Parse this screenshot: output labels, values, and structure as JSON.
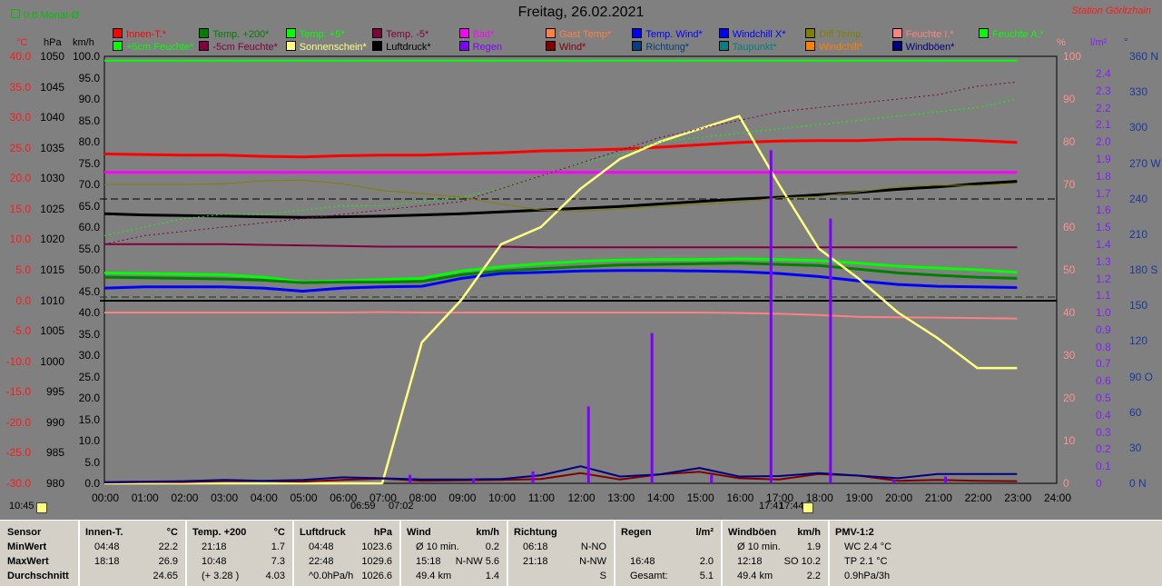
{
  "header": {
    "title": "Freitag, 26.02.2021",
    "station": "Station Göritzhain",
    "monat": "0.8 Monat-Ø"
  },
  "legend": [
    {
      "label": "Innen-T.*",
      "color": "#ff0000"
    },
    {
      "label": "Temp. +200*",
      "color": "#008000"
    },
    {
      "label": "Temp. +5*",
      "color": "#00ff00"
    },
    {
      "label": "Temp. -5*",
      "color": "#800040"
    },
    {
      "label": "Bad*",
      "color": "#ff00ff"
    },
    {
      "label": "Gast Temp*",
      "color": "#ff8040"
    },
    {
      "label": "Temp. Wind*",
      "color": "#0000ff"
    },
    {
      "label": "Windchill X*",
      "color": "#0000ff"
    },
    {
      "label": "Diff Temp.",
      "color": "#808000"
    },
    {
      "label": "Feuchte I.*",
      "color": "#ff8080"
    },
    {
      "label": "Feuchte A.*",
      "color": "#00ff00"
    },
    {
      "label": "+5cm Feuchte*",
      "color": "#00ff00"
    },
    {
      "label": "-5cm Feuchte*",
      "color": "#800040"
    },
    {
      "label": "Sonnenschein*",
      "color": "#ffff80"
    },
    {
      "label": "Luftdruck*",
      "color": "#000000"
    },
    {
      "label": "Regen",
      "color": "#8000ff"
    },
    {
      "label": "Wind*",
      "color": "#800000"
    },
    {
      "label": "Richtung*",
      "color": "#004080"
    },
    {
      "label": "Taupunkt*",
      "color": "#008080"
    },
    {
      "label": "Windchill*",
      "color": "#ff8000"
    },
    {
      "label": "Windböen*",
      "color": "#000080"
    }
  ],
  "axis_units": {
    "temp": "°C",
    "hpa": "hPa",
    "kmh": "km/h",
    "pct": "%",
    "rain": "l/m²",
    "dir": "°"
  },
  "axis_ticks": {
    "temp": [
      "40.0",
      "35.0",
      "30.0",
      "25.0",
      "20.0",
      "15.0",
      "10.0",
      "5.0",
      "0.0",
      "-5.0",
      "-10.0",
      "-15.0",
      "-20.0",
      "-25.0",
      "-30.0"
    ],
    "hpa": [
      "1050",
      "1045",
      "1040",
      "1035",
      "1030",
      "1025",
      "1020",
      "1015",
      "1010",
      "1005",
      "1000",
      "995",
      "990",
      "985",
      "980"
    ],
    "kmh": [
      "100.0",
      "95.0",
      "90.0",
      "85.0",
      "80.0",
      "75.0",
      "70.0",
      "65.0",
      "60.0",
      "55.0",
      "50.0",
      "45.0",
      "40.0",
      "35.0",
      "30.0",
      "25.0",
      "20.0",
      "15.0",
      "10.0",
      "5.0",
      "0.0"
    ],
    "pct": [
      "100",
      "90",
      "80",
      "70",
      "60",
      "50",
      "40",
      "30",
      "20",
      "10",
      "0"
    ],
    "rain": [
      "2.4",
      "2.3",
      "2.2",
      "2.1",
      "2.0",
      "1.9",
      "1.8",
      "1.7",
      "1.6",
      "1.5",
      "1.4",
      "1.3",
      "1.2",
      "1.1",
      "1.0",
      "0.9",
      "0.8",
      "0.7",
      "0.6",
      "0.5",
      "0.4",
      "0.3",
      "0.2",
      "0.1",
      "0"
    ],
    "dir": [
      "360 N",
      "330",
      "300",
      "270 W",
      "240",
      "210",
      "180 S",
      "150",
      "120",
      "90 O",
      "60",
      "30",
      "0 N"
    ]
  },
  "time_ticks": [
    "00:00",
    "01:00",
    "02:00",
    "03:00",
    "04:00",
    "05:00",
    "06:00",
    "07:00",
    "08:00",
    "09:00",
    "10:00",
    "11:00",
    "12:00",
    "13:00",
    "14:00",
    "15:00",
    "16:00",
    "17:00",
    "18:00",
    "19:00",
    "20:00",
    "21:00",
    "22:00",
    "23:00",
    "24:00"
  ],
  "sun_marks": {
    "left": "10:45",
    "rise": "06:59",
    "rise2": "07:02",
    "set": "17:41",
    "set2": "17:44"
  },
  "chart_data": {
    "type": "line",
    "title": "Freitag, 26.02.2021",
    "x": [
      0,
      1,
      2,
      3,
      4,
      5,
      6,
      7,
      8,
      9,
      10,
      11,
      12,
      13,
      14,
      15,
      16,
      17,
      18,
      19,
      20,
      21,
      22,
      23
    ],
    "xlim": [
      0,
      24
    ],
    "series": [
      {
        "name": "Innen-T.*",
        "axis": "temp",
        "color": "#ff0000",
        "values": [
          24.0,
          23.9,
          23.8,
          23.8,
          23.6,
          23.5,
          23.7,
          23.8,
          23.8,
          24.0,
          24.2,
          24.5,
          24.6,
          24.8,
          25.1,
          25.5,
          25.9,
          26.1,
          26.2,
          26.2,
          26.4,
          26.4,
          26.2,
          25.9
        ]
      },
      {
        "name": "Bad*",
        "axis": "temp",
        "color": "#ff00ff",
        "values": [
          21.0,
          21.0,
          21.0,
          21.0,
          21.0,
          21.0,
          21.0,
          21.0,
          21.0,
          21.0,
          21.0,
          21.0,
          21.0,
          21.0,
          21.0,
          21.0,
          21.0,
          21.0,
          21.0,
          21.0,
          21.0,
          21.0,
          21.0,
          21.0
        ]
      },
      {
        "name": "Feuchte A.*",
        "axis": "pct",
        "color": "#00ff00",
        "values": [
          99,
          99,
          99,
          99,
          99,
          99,
          99,
          99,
          99,
          99,
          99,
          99,
          99,
          99,
          99,
          99,
          99,
          99,
          99,
          99,
          99,
          99,
          99,
          99
        ]
      },
      {
        "name": "Luftdruck*",
        "axis": "hpa",
        "color": "#000000",
        "values": [
          1024.2,
          1024.0,
          1023.9,
          1023.8,
          1023.7,
          1023.6,
          1023.7,
          1023.8,
          1024.0,
          1024.2,
          1024.5,
          1024.8,
          1025.1,
          1025.4,
          1025.8,
          1026.2,
          1026.6,
          1026.9,
          1027.3,
          1027.7,
          1028.2,
          1028.6,
          1029.1,
          1029.5
        ]
      },
      {
        "name": "Temp. -5*",
        "axis": "temp",
        "color": "#800040",
        "values": [
          9.2,
          9.2,
          9.2,
          9.2,
          9.1,
          9.0,
          8.9,
          8.8,
          8.8,
          8.8,
          8.8,
          8.7,
          8.7,
          8.7,
          8.7,
          8.7,
          8.7,
          8.7,
          8.7,
          8.7,
          8.7,
          8.7,
          8.7,
          8.7
        ]
      },
      {
        "name": "Temp. +5*",
        "axis": "temp",
        "color": "#00ff00",
        "values": [
          4.5,
          4.4,
          4.3,
          4.2,
          3.8,
          3.0,
          3.2,
          3.4,
          3.6,
          4.8,
          5.5,
          6.0,
          6.4,
          6.6,
          6.7,
          6.7,
          6.8,
          6.7,
          6.5,
          6.1,
          5.6,
          5.3,
          5.0,
          4.6
        ]
      },
      {
        "name": "Temp. +200*",
        "axis": "temp",
        "color": "#008000",
        "values": [
          3.8,
          3.7,
          3.6,
          3.5,
          3.3,
          2.9,
          3.0,
          3.0,
          3.1,
          4.2,
          4.8,
          5.2,
          5.5,
          5.8,
          5.9,
          6.0,
          6.1,
          5.9,
          5.7,
          5.1,
          4.5,
          4.1,
          3.8,
          3.6
        ]
      },
      {
        "name": "Temp. Wind*",
        "axis": "temp",
        "color": "#0000ff",
        "values": [
          2.0,
          2.2,
          2.2,
          2.2,
          2.0,
          1.5,
          2.0,
          2.2,
          2.3,
          3.6,
          4.4,
          4.6,
          4.8,
          4.9,
          4.9,
          4.8,
          4.7,
          4.4,
          3.9,
          3.2,
          2.6,
          2.3,
          2.2,
          2.1
        ]
      },
      {
        "name": "Feuchte I.*",
        "axis": "pct",
        "color": "#ff8080",
        "values": [
          40.0,
          40.0,
          40.0,
          40.0,
          40.0,
          40.0,
          40.0,
          40.1,
          40.0,
          40.0,
          40.0,
          40.0,
          40.0,
          40.0,
          40.0,
          40.0,
          39.9,
          39.7,
          39.4,
          39.0,
          38.9,
          38.8,
          38.7,
          38.6
        ]
      },
      {
        "name": "Sonnenschein*",
        "axis": "kmh",
        "color": "#ffff80",
        "values": [
          0,
          0,
          0,
          0,
          0,
          0,
          0,
          0,
          33,
          43,
          56,
          60,
          69,
          76,
          80,
          83,
          86,
          70,
          55,
          48,
          40,
          34,
          27,
          27
        ]
      },
      {
        "name": "Diff Temp.",
        "axis": "temp",
        "color": "#808000",
        "values": [
          19.0,
          19.0,
          19.0,
          19.1,
          19.6,
          19.7,
          19.1,
          18.0,
          17.5,
          16.9,
          15.8,
          14.8,
          14.6,
          15.0,
          15.4,
          15.7,
          16.1,
          16.8,
          17.0,
          17.8,
          18.6,
          18.9,
          18.8,
          19.2
        ]
      },
      {
        "name": "+5cm Feuchte*",
        "axis": "kmh",
        "color": "#00ff00",
        "values": [
          58,
          60,
          62,
          63,
          63,
          64,
          65,
          65,
          66,
          67,
          69,
          72,
          75,
          77,
          80,
          81,
          82,
          83,
          84,
          85,
          86,
          87,
          88,
          90
        ]
      },
      {
        "name": "-5cm Feuchte*",
        "axis": "kmh",
        "color": "#800040",
        "values": [
          56,
          58,
          59,
          60,
          61,
          62,
          63,
          64,
          65,
          66,
          69,
          72,
          75,
          78,
          81,
          83,
          85,
          87,
          88,
          89,
          90,
          91,
          93,
          94
        ]
      },
      {
        "name": "Wind*",
        "axis": "kmh",
        "color": "#800000",
        "values": [
          0.2,
          0.3,
          0.3,
          0.5,
          0.5,
          0.4,
          0.8,
          1.1,
          0.6,
          0.7,
          0.8,
          1.0,
          2.4,
          0.9,
          2.1,
          2.7,
          1.2,
          0.9,
          2.2,
          1.8,
          0.6,
          0.8,
          0.6,
          0.5
        ]
      },
      {
        "name": "Windböen*",
        "axis": "kmh",
        "color": "#000080",
        "values": [
          0.3,
          0.4,
          0.5,
          0.8,
          0.6,
          0.8,
          1.4,
          1.2,
          0.9,
          0.9,
          1.0,
          1.9,
          4.0,
          1.6,
          2.1,
          3.6,
          1.6,
          1.7,
          2.4,
          1.8,
          1.2,
          2.2,
          2.2,
          2.2
        ]
      }
    ],
    "rain_bars": {
      "axis": "rain",
      "color": "#8000ff",
      "x": [
        7.7,
        9.3,
        10.8,
        12.2,
        13.8,
        15.3,
        16.8,
        18.3,
        19.9,
        21.2
      ],
      "values": [
        0.05,
        0.03,
        0.07,
        0.45,
        0.88,
        0.05,
        1.95,
        1.55,
        0.02,
        0.04
      ]
    }
  },
  "table": {
    "sensor": {
      "head": "Sensor",
      "rows": [
        "MinWert",
        "MaxWert",
        "Durchschnitt"
      ]
    },
    "innen": {
      "head": "Innen-T.",
      "unit": "°C",
      "rows": [
        [
          "04:48",
          "22.2"
        ],
        [
          "18:18",
          "26.9"
        ],
        [
          "",
          "24.65"
        ]
      ]
    },
    "temp200": {
      "head": "Temp. +200",
      "unit": "°C",
      "rows": [
        [
          "21:18",
          "1.7"
        ],
        [
          "10:48",
          "7.3"
        ],
        [
          "(+ 3.28 )",
          "4.03"
        ]
      ]
    },
    "luftdruck": {
      "head": "Luftdruck",
      "unit": "hPa",
      "rows": [
        [
          "04:48",
          "1023.6"
        ],
        [
          "22:48",
          "1029.6"
        ],
        [
          "^0.0hPa/h",
          "1026.6"
        ]
      ]
    },
    "wind": {
      "head": "Wind",
      "unit": "km/h",
      "rows": [
        [
          "Ø 10 min.",
          "0.2"
        ],
        [
          "15:18",
          "N-NW 5.6"
        ],
        [
          "49.4 km",
          "1.4"
        ]
      ]
    },
    "richtung": {
      "head": "Richtung",
      "unit": "",
      "rows": [
        [
          "06:18",
          "N-NO"
        ],
        [
          "21:18",
          "N-NW"
        ],
        [
          "",
          "S"
        ]
      ]
    },
    "regen": {
      "head": "Regen",
      "unit": "l/m²",
      "rows": [
        [
          "",
          ""
        ],
        [
          "16:48",
          "2.0"
        ],
        [
          "Gesamt:",
          "5.1"
        ]
      ]
    },
    "windboeen": {
      "head": "Windböen",
      "unit": "km/h",
      "rows": [
        [
          "Ø 10 min.",
          "1.9"
        ],
        [
          "12:18",
          "SO 10.2"
        ],
        [
          "49.4 km",
          "2.2"
        ]
      ]
    },
    "pmv": {
      "head": "PMV-1:2",
      "unit": "",
      "rows": [
        [
          "WC 2.4 °C",
          ""
        ],
        [
          "TP 2.1 °C",
          ""
        ],
        [
          "0.9hPa/3h",
          ""
        ]
      ]
    }
  }
}
